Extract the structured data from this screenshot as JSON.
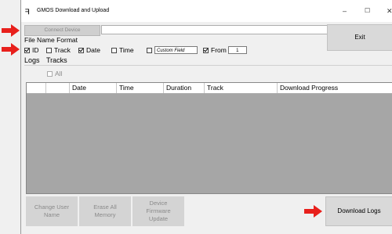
{
  "window": {
    "title": "GMOS Download and Upload",
    "icon": "app-logo-icon",
    "controls": {
      "minimize": "–",
      "maximize": "☐",
      "close": "✕"
    }
  },
  "toolbar": {
    "connect_label": "Connect Device",
    "device_value": "",
    "exit_label": "Exit"
  },
  "file_name_format": {
    "heading": "File Name Format",
    "options": {
      "id": {
        "label": "ID",
        "checked": true
      },
      "track": {
        "label": "Track",
        "checked": false
      },
      "date": {
        "label": "Date",
        "checked": true
      },
      "time": {
        "label": "Time",
        "checked": false
      },
      "custom": {
        "placeholder": "Custom Field",
        "checked": false
      },
      "from": {
        "label": "From",
        "checked": true,
        "value": "1"
      }
    }
  },
  "tabs": [
    "Logs",
    "Tracks"
  ],
  "all_label": "All",
  "table": {
    "columns": [
      "",
      "Date",
      "Time",
      "Duration",
      "Track",
      "Download Progress"
    ],
    "rows": []
  },
  "actions": {
    "change_user": "Change User\nName",
    "erase_all": "Erase All\nMemory",
    "firmware": "Device\nFirmware\nUpdate",
    "download_logs": "Download Logs"
  },
  "colors": {
    "arrow": "#e8201c",
    "table_bg": "#a6a6a6"
  }
}
